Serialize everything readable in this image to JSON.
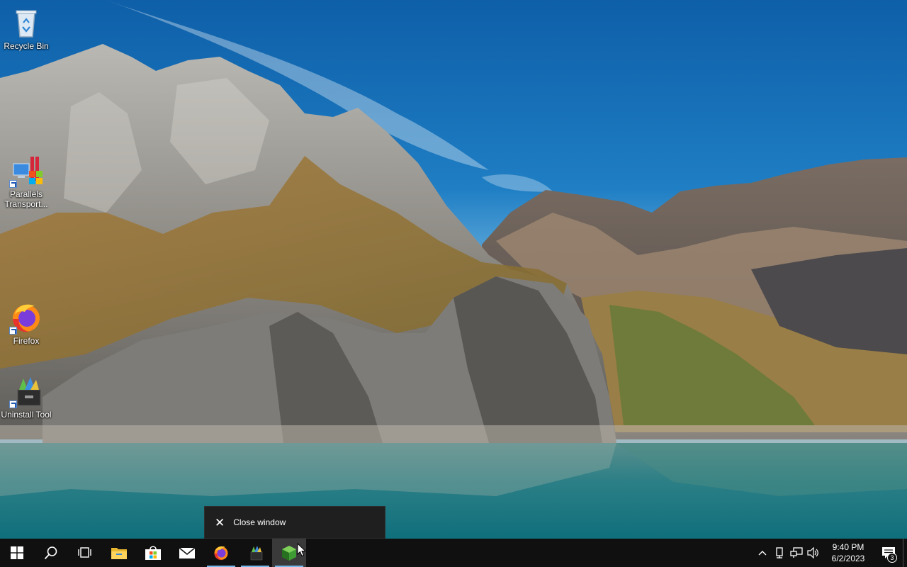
{
  "desktop": {
    "icons": [
      {
        "label": "Recycle Bin",
        "icon": "recycle-bin-icon"
      },
      {
        "label": "Parallels Transport...",
        "icon": "parallels-transport-icon"
      },
      {
        "label": "Firefox",
        "icon": "firefox-icon"
      },
      {
        "label": "Uninstall Tool",
        "icon": "uninstall-tool-icon"
      }
    ]
  },
  "tooltip": {
    "label": "Close window",
    "icon": "close-icon"
  },
  "taskbar": {
    "buttons": [
      {
        "name": "start",
        "icon": "windows-logo-icon"
      },
      {
        "name": "search",
        "icon": "search-icon"
      },
      {
        "name": "task-view",
        "icon": "task-view-icon"
      },
      {
        "name": "file-explorer",
        "icon": "folder-icon"
      },
      {
        "name": "microsoft-store",
        "icon": "store-bag-icon"
      },
      {
        "name": "mail",
        "icon": "mail-icon"
      },
      {
        "name": "firefox",
        "icon": "firefox-icon"
      },
      {
        "name": "uninstall-tool",
        "icon": "uninstall-tool-icon"
      },
      {
        "name": "parallels-app",
        "icon": "cube-icon"
      }
    ],
    "tray": {
      "icons": [
        "chevron-up-icon",
        "network-device-icon",
        "network-icon",
        "volume-icon"
      ],
      "time": "9:40 PM",
      "date": "6/2/2023",
      "notification_count": "3"
    }
  },
  "colors": {
    "taskbar": "#101010",
    "tooltip": "#1f1f1f",
    "accent": "#76b9ed"
  }
}
